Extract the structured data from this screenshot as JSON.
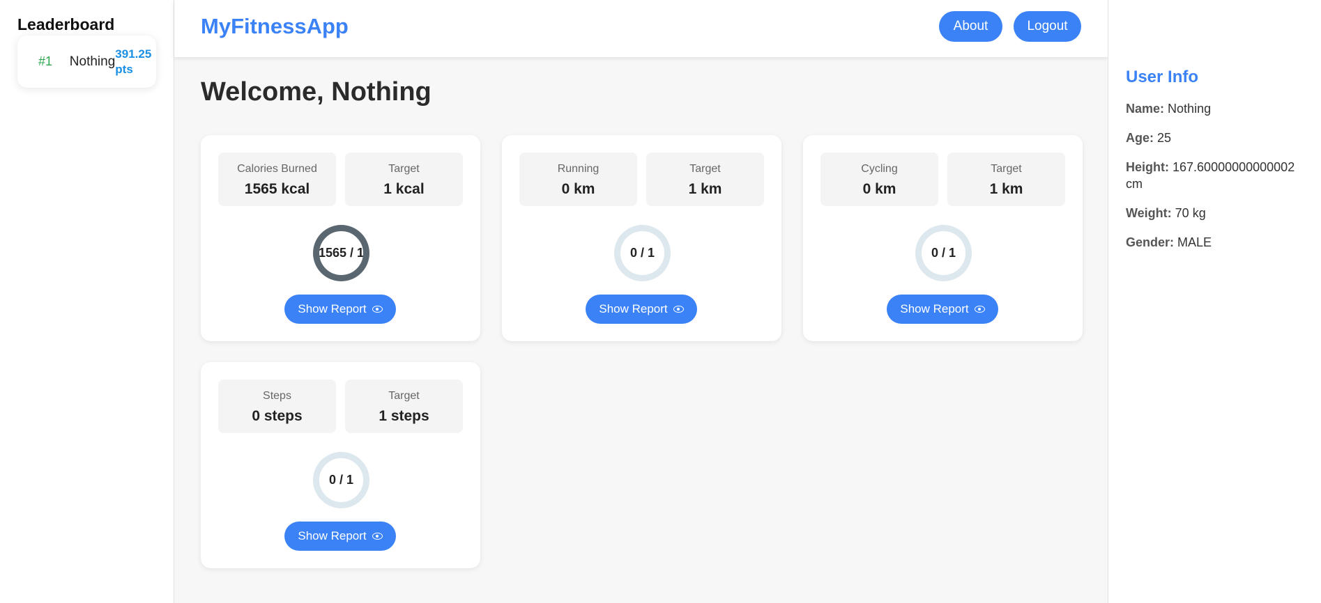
{
  "leaderboard": {
    "title": "Leaderboard",
    "entries": [
      {
        "rank": "#1",
        "name": "Nothing",
        "points": "391.25 pts"
      }
    ]
  },
  "header": {
    "brand": "MyFitnessApp",
    "about_label": "About",
    "logout_label": "Logout"
  },
  "main": {
    "welcome": "Welcome, Nothing",
    "cards": [
      {
        "metric_label": "Calories Burned",
        "metric_value": "1565 kcal",
        "target_label": "Target",
        "target_value": "1 kcal",
        "ring_text": "1565 / 1",
        "progress": 1.0,
        "report_label": "Show Report"
      },
      {
        "metric_label": "Running",
        "metric_value": "0 km",
        "target_label": "Target",
        "target_value": "1 km",
        "ring_text": "0 / 1",
        "progress": 0.0,
        "report_label": "Show Report"
      },
      {
        "metric_label": "Cycling",
        "metric_value": "0 km",
        "target_label": "Target",
        "target_value": "1 km",
        "ring_text": "0 / 1",
        "progress": 0.0,
        "report_label": "Show Report"
      },
      {
        "metric_label": "Steps",
        "metric_value": "0 steps",
        "target_label": "Target",
        "target_value": "1 steps",
        "ring_text": "0 / 1",
        "progress": 0.0,
        "report_label": "Show Report"
      }
    ]
  },
  "user_info": {
    "title": "User Info",
    "name_label": "Name:",
    "name": "Nothing",
    "age_label": "Age:",
    "age": "25",
    "height_label": "Height:",
    "height": "167.60000000000002 cm",
    "weight_label": "Weight:",
    "weight": "70 kg",
    "gender_label": "Gender:",
    "gender": "MALE"
  },
  "colors": {
    "accent": "#3b82f6",
    "rank": "#2ea84f",
    "points": "#1a8fe3",
    "ring_empty": "#dde7ee",
    "ring_full": "#5b6770"
  }
}
